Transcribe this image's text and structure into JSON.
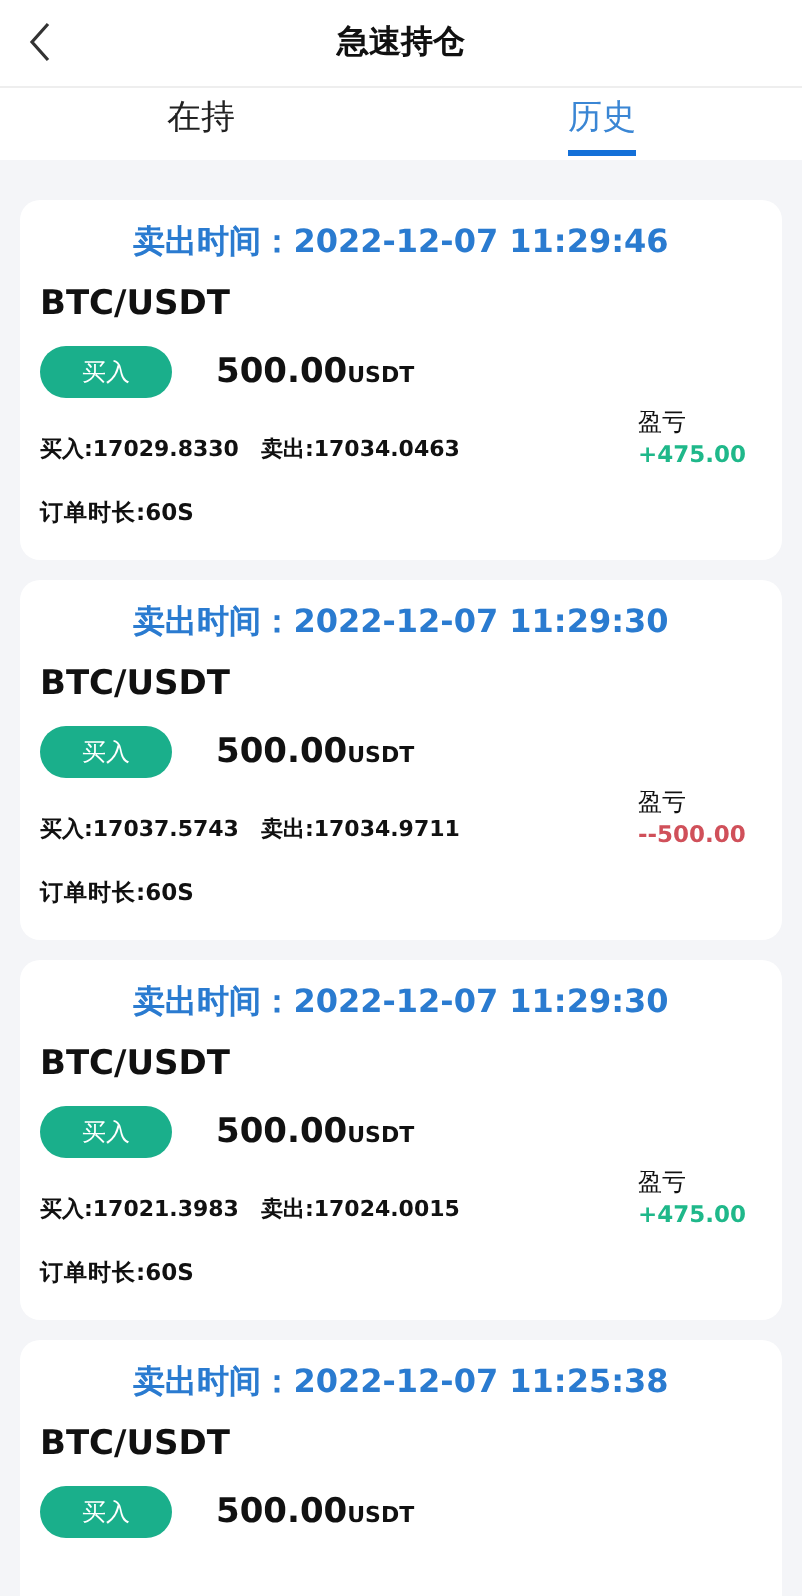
{
  "header": {
    "title": "急速持仓"
  },
  "tabs": [
    {
      "label": "在持",
      "selected": false
    },
    {
      "label": "历史",
      "selected": true
    }
  ],
  "orders": [
    {
      "sell_time": "卖出时间：2022-12-07 11:29:46",
      "pair": "BTC/USDT",
      "side": "买入",
      "amount": "500.00",
      "unit": "USDT",
      "prices": "买入:17029.8330　卖出:17034.0463",
      "profit_label": "盈亏",
      "profit": "+475.00",
      "color": "#1fb88a",
      "duration": "订单时长:60S"
    },
    {
      "sell_time": "卖出时间：2022-12-07 11:29:30",
      "pair": "BTC/USDT",
      "side": "买入",
      "amount": "500.00",
      "unit": "USDT",
      "prices": "买入:17037.5743　卖出:17034.9711",
      "profit_label": "盈亏",
      "profit": "--500.00",
      "color": "#d0505a",
      "duration": "订单时长:60S"
    },
    {
      "sell_time": "卖出时间：2022-12-07 11:29:30",
      "pair": "BTC/USDT",
      "side": "买入",
      "amount": "500.00",
      "unit": "USDT",
      "prices": "买入:17021.3983　卖出:17024.0015",
      "profit_label": "盈亏",
      "profit": "+475.00",
      "color": "#1fb88a",
      "duration": "订单时长:60S"
    },
    {
      "sell_time": "卖出时间：2022-12-07 11:25:38",
      "pair": "BTC/USDT",
      "side": "买入",
      "amount": "500.00",
      "unit": "USDT"
    }
  ]
}
